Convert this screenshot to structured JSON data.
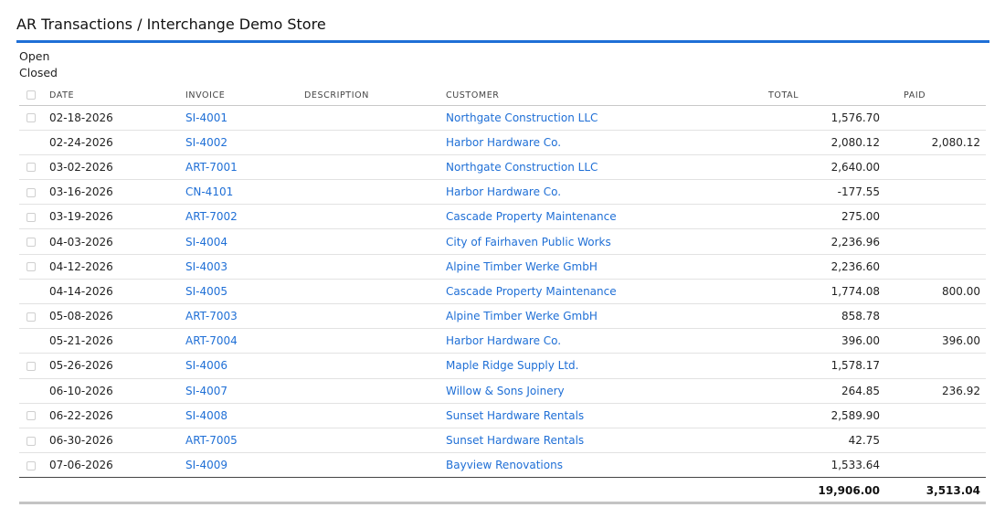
{
  "header": {
    "title": "AR Transactions / Interchange Demo Store"
  },
  "filters": {
    "open_label": "Open",
    "closed_label": "Closed"
  },
  "table": {
    "columns": {
      "date": "DATE",
      "invoice": "INVOICE",
      "description": "DESCRIPTION",
      "customer": "CUSTOMER",
      "total": "TOTAL",
      "paid": "PAID"
    },
    "rows": [
      {
        "checkbox": true,
        "date": "02-18-2026",
        "invoice": "SI-4001",
        "description": "",
        "customer": "Northgate Construction LLC",
        "total": "1,576.70",
        "paid": ""
      },
      {
        "checkbox": false,
        "date": "02-24-2026",
        "invoice": "SI-4002",
        "description": "",
        "customer": "Harbor Hardware Co.",
        "total": "2,080.12",
        "paid": "2,080.12"
      },
      {
        "checkbox": true,
        "date": "03-02-2026",
        "invoice": "ART-7001",
        "description": "",
        "customer": "Northgate Construction LLC",
        "total": "2,640.00",
        "paid": ""
      },
      {
        "checkbox": true,
        "date": "03-16-2026",
        "invoice": "CN-4101",
        "description": "",
        "customer": "Harbor Hardware Co.",
        "total": "-177.55",
        "paid": ""
      },
      {
        "checkbox": true,
        "date": "03-19-2026",
        "invoice": "ART-7002",
        "description": "",
        "customer": "Cascade Property Maintenance",
        "total": "275.00",
        "paid": ""
      },
      {
        "checkbox": true,
        "date": "04-03-2026",
        "invoice": "SI-4004",
        "description": "",
        "customer": "City of Fairhaven Public Works",
        "total": "2,236.96",
        "paid": ""
      },
      {
        "checkbox": true,
        "date": "04-12-2026",
        "invoice": "SI-4003",
        "description": "",
        "customer": "Alpine Timber Werke GmbH",
        "total": "2,236.60",
        "paid": ""
      },
      {
        "checkbox": false,
        "date": "04-14-2026",
        "invoice": "SI-4005",
        "description": "",
        "customer": "Cascade Property Maintenance",
        "total": "1,774.08",
        "paid": "800.00"
      },
      {
        "checkbox": true,
        "date": "05-08-2026",
        "invoice": "ART-7003",
        "description": "",
        "customer": "Alpine Timber Werke GmbH",
        "total": "858.78",
        "paid": ""
      },
      {
        "checkbox": false,
        "date": "05-21-2026",
        "invoice": "ART-7004",
        "description": "",
        "customer": "Harbor Hardware Co.",
        "total": "396.00",
        "paid": "396.00"
      },
      {
        "checkbox": true,
        "date": "05-26-2026",
        "invoice": "SI-4006",
        "description": "",
        "customer": "Maple Ridge Supply Ltd.",
        "total": "1,578.17",
        "paid": ""
      },
      {
        "checkbox": false,
        "date": "06-10-2026",
        "invoice": "SI-4007",
        "description": "",
        "customer": "Willow & Sons Joinery",
        "total": "264.85",
        "paid": "236.92"
      },
      {
        "checkbox": true,
        "date": "06-22-2026",
        "invoice": "SI-4008",
        "description": "",
        "customer": "Sunset Hardware Rentals",
        "total": "2,589.90",
        "paid": ""
      },
      {
        "checkbox": true,
        "date": "06-30-2026",
        "invoice": "ART-7005",
        "description": "",
        "customer": "Sunset Hardware Rentals",
        "total": "42.75",
        "paid": ""
      },
      {
        "checkbox": true,
        "date": "07-06-2026",
        "invoice": "SI-4009",
        "description": "",
        "customer": "Bayview Renovations",
        "total": "1,533.64",
        "paid": ""
      }
    ],
    "totals": {
      "total": "19,906.00",
      "paid": "3,513.04"
    }
  },
  "colors": {
    "accent": "#1f6fd6",
    "link": "#1f6fd6"
  }
}
